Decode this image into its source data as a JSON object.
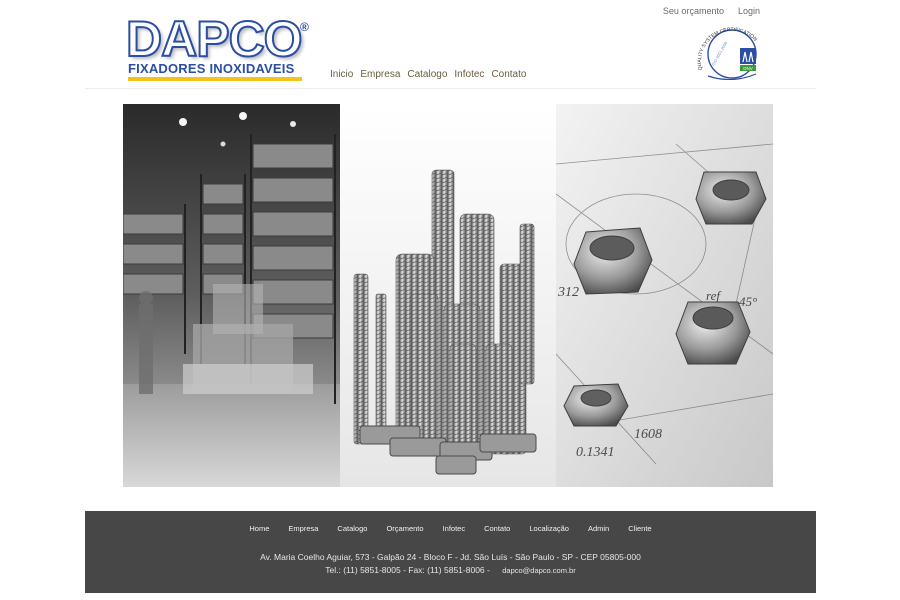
{
  "top_links": {
    "quote": "Seu orçamento",
    "login": "Login"
  },
  "logo": {
    "name": "DAPCO",
    "registered": "®",
    "subtitle": "FIXADORES INOXIDAVEIS"
  },
  "main_nav": [
    "Inicio",
    "Empresa",
    "Catalogo",
    "Infotec",
    "Contato"
  ],
  "certification": {
    "arc_text": "QUALITY SYSTEM CERTIFICATION",
    "standard": "ISO 9001:2008",
    "mark": "DNV"
  },
  "hero": {
    "panels": [
      "warehouse-photo",
      "bolts-photo",
      "nuts-drawing-photo"
    ],
    "drawing_texts": [
      "312",
      "ref",
      "45°",
      "1608",
      "0.1341"
    ]
  },
  "footer": {
    "nav": [
      "Home",
      "Empresa",
      "Catalogo",
      "Orçamento",
      "Infotec",
      "Contato",
      "Localização",
      "Admin",
      "Cliente"
    ],
    "address": "Av. Maria Coelho Aguiar, 573 - Galpão 24 - Bloco F - Jd. São Luís - São Paulo - SP - CEP 05805-000",
    "phones": "Tel.: (11) 5851-8005 - Fax: (11) 5851-8006 -",
    "email": "dapco@dapco.com.br"
  },
  "colors": {
    "brand_blue": "#2b4ea2",
    "brand_yellow": "#f0c419",
    "nav_text": "#6b5e3f",
    "footer_bg": "#474747"
  }
}
